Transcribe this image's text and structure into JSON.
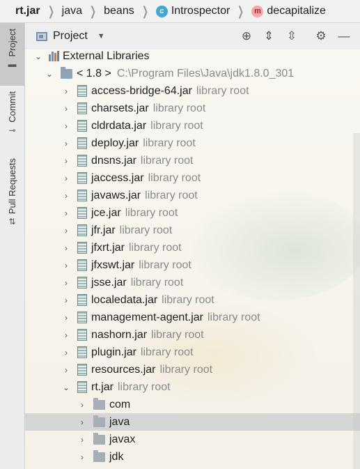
{
  "breadcrumb": {
    "items": [
      {
        "label": "rt.jar",
        "icon": ""
      },
      {
        "label": "java",
        "icon": ""
      },
      {
        "label": "beans",
        "icon": ""
      },
      {
        "label": "Introspector",
        "icon": "class-icon",
        "icon_text": "c"
      },
      {
        "label": "decapitalize",
        "icon": "method-icon",
        "icon_text": "m"
      }
    ]
  },
  "sidebar": {
    "tabs": [
      {
        "label": "Project",
        "icon": "folder-icon"
      },
      {
        "label": "Commit",
        "icon": "commit-icon"
      },
      {
        "label": "Pull Requests",
        "icon": "pull-request-icon"
      }
    ]
  },
  "panel": {
    "title": "Project",
    "icons": [
      "locate-icon",
      "expand-all-icon",
      "collapse-all-icon",
      "settings-icon",
      "hide-icon"
    ]
  },
  "tree": {
    "external_libraries": "External Libraries",
    "sdk": {
      "label": "< 1.8 >",
      "path": "C:\\Program Files\\Java\\jdk1.8.0_301"
    },
    "library_root_text": "library root",
    "jars": [
      "access-bridge-64.jar",
      "charsets.jar",
      "cldrdata.jar",
      "deploy.jar",
      "dnsns.jar",
      "jaccess.jar",
      "javaws.jar",
      "jce.jar",
      "jfr.jar",
      "jfxrt.jar",
      "jfxswt.jar",
      "jsse.jar",
      "localedata.jar",
      "management-agent.jar",
      "nashorn.jar",
      "plugin.jar",
      "resources.jar"
    ],
    "rt": {
      "label": "rt.jar",
      "packages": [
        "com",
        "java",
        "javax",
        "jdk"
      ],
      "selected": "java"
    }
  }
}
